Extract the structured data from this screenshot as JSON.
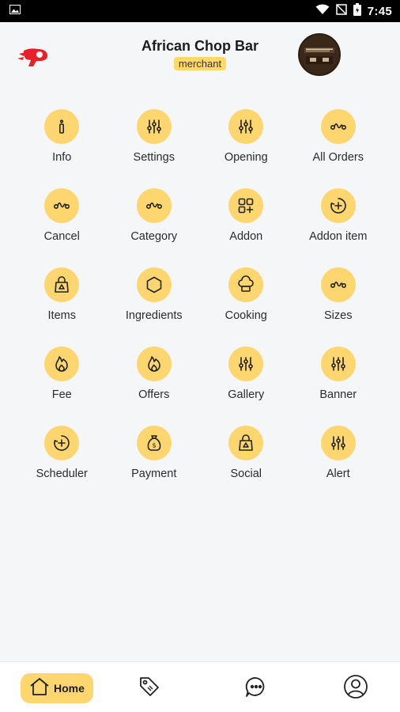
{
  "status_bar": {
    "time": "7:45",
    "icons": [
      "image-icon",
      "wifi-icon",
      "no-sim-icon",
      "battery-icon"
    ]
  },
  "header": {
    "merchant_name": "African Chop Bar",
    "role_badge": "merchant",
    "logo_icon": "brand-logo",
    "avatar_icon": "restaurant-avatar"
  },
  "menu": {
    "items": [
      {
        "label": "Info",
        "icon": "info-icon"
      },
      {
        "label": "Settings",
        "icon": "sliders-icon"
      },
      {
        "label": "Opening",
        "icon": "sliders-icon"
      },
      {
        "label": "All Orders",
        "icon": "route-icon"
      },
      {
        "label": "Cancel",
        "icon": "route-icon"
      },
      {
        "label": "Category",
        "icon": "route-icon"
      },
      {
        "label": "Addon",
        "icon": "grid-plus-icon"
      },
      {
        "label": "Addon item",
        "icon": "add-circle-icon"
      },
      {
        "label": "Items",
        "icon": "bag-icon"
      },
      {
        "label": "Ingredients",
        "icon": "hexagon-icon"
      },
      {
        "label": "Cooking",
        "icon": "chef-hat-icon"
      },
      {
        "label": "Sizes",
        "icon": "route-icon"
      },
      {
        "label": "Fee",
        "icon": "flame-icon"
      },
      {
        "label": "Offers",
        "icon": "flame-icon"
      },
      {
        "label": "Gallery",
        "icon": "sliders-icon"
      },
      {
        "label": "Banner",
        "icon": "sliders-icon"
      },
      {
        "label": "Scheduler",
        "icon": "add-circle-icon"
      },
      {
        "label": "Payment",
        "icon": "money-bag-icon"
      },
      {
        "label": "Social",
        "icon": "bag-icon"
      },
      {
        "label": "Alert",
        "icon": "sliders-icon"
      }
    ]
  },
  "bottom_nav": {
    "home_label": "Home",
    "active": "home",
    "items": [
      "home-icon",
      "tag-icon",
      "chat-icon",
      "profile-icon"
    ]
  },
  "colors": {
    "accent": "#fdd66f",
    "background": "#f5f6f8",
    "text": "#2b2b2b"
  }
}
